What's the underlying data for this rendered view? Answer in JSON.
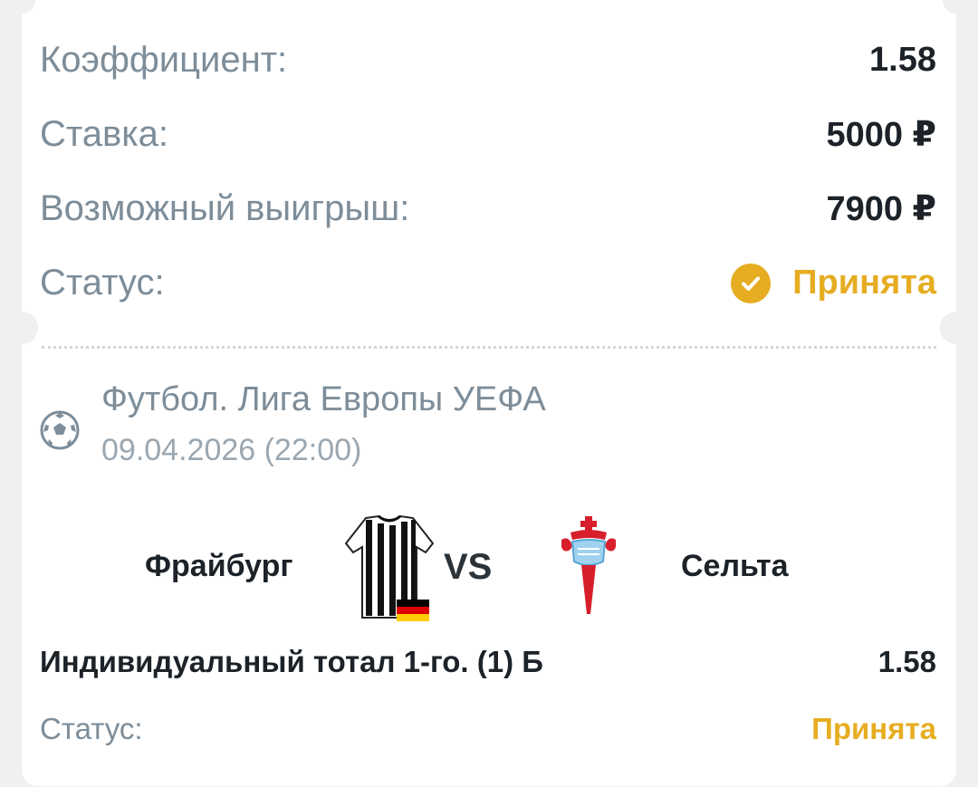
{
  "summary": {
    "odds_label": "Коэффициент:",
    "odds_value": "1.58",
    "stake_label": "Ставка:",
    "stake_value": "5000 ₽",
    "win_label": "Возможный выигрыш:",
    "win_value": "7900 ₽",
    "status_label": "Статус:",
    "status_value": "Принята"
  },
  "event": {
    "sport_icon": "soccer-ball-icon",
    "title": "Футбол. Лига Европы УЕФА",
    "datetime": "09.04.2026 (22:00)",
    "home_team": "Фрайбург",
    "away_team": "Сельта",
    "vs_label": "VS",
    "market": "Индивидуальный тотал 1-го. (1) Б",
    "market_odds": "1.58",
    "status_label": "Статус:",
    "status_value": "Принята"
  },
  "colors": {
    "accent": "#e6ad22",
    "label": "#7d8d99",
    "value": "#1c2228"
  }
}
